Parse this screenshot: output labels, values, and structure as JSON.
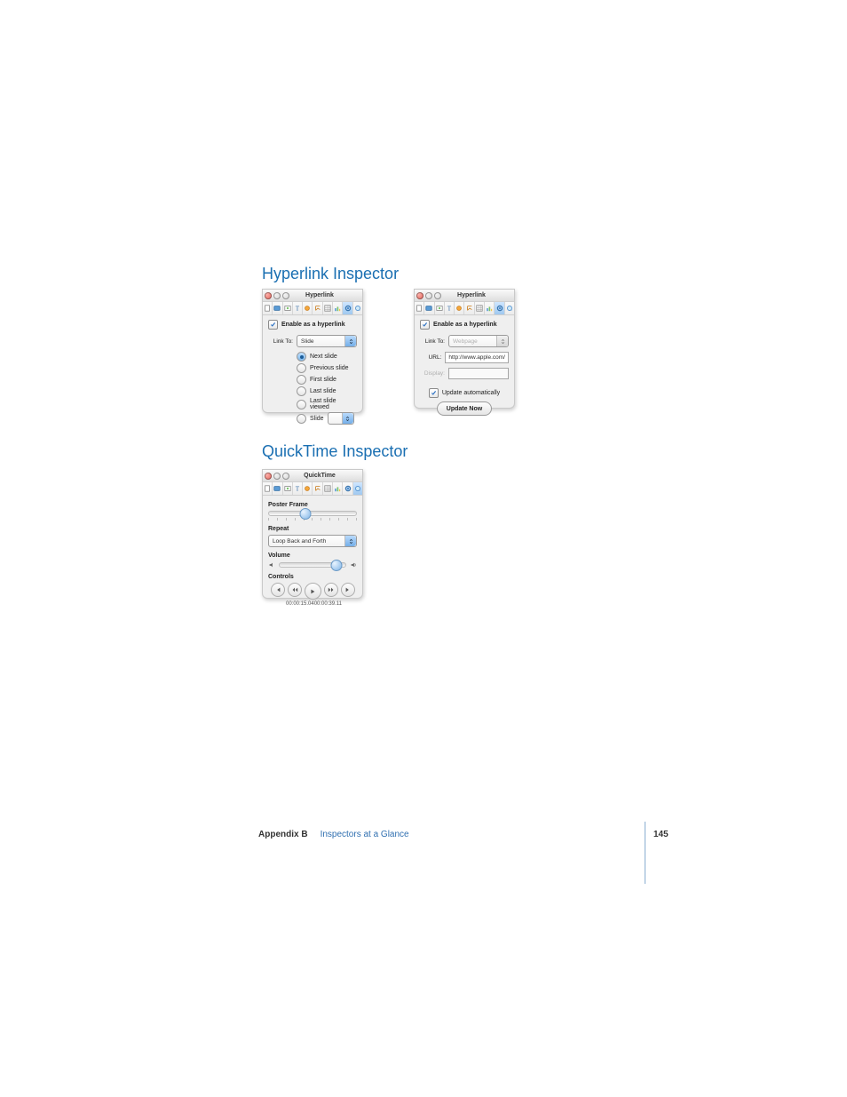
{
  "headings": {
    "hyperlink": "Hyperlink Inspector",
    "quicktime": "QuickTime Inspector"
  },
  "hyperlink_slide": {
    "title": "Hyperlink",
    "enable_label": "Enable as a hyperlink",
    "link_to_label": "Link To:",
    "link_to_value": "Slide",
    "options": {
      "next": "Next slide",
      "previous": "Previous slide",
      "first": "First slide",
      "last": "Last slide",
      "last_viewed": "Last slide viewed",
      "slide": "Slide"
    }
  },
  "hyperlink_web": {
    "title": "Hyperlink",
    "enable_label": "Enable as a hyperlink",
    "link_to_label": "Link To:",
    "link_to_value": "Webpage",
    "url_label": "URL:",
    "url_value": "http://www.apple.com/",
    "display_label": "Display:",
    "display_value": "",
    "update_auto_label": "Update automatically",
    "update_now_label": "Update Now"
  },
  "quicktime": {
    "title": "QuickTime",
    "poster_label": "Poster Frame",
    "repeat_label": "Repeat",
    "repeat_value": "Loop Back and Forth",
    "volume_label": "Volume",
    "controls_label": "Controls",
    "time_left": "00:00:15.04",
    "time_right": "00:00:39.11"
  },
  "footer": {
    "appendix": "Appendix B",
    "section": "Inspectors at a Glance",
    "page": "145"
  },
  "icons": {
    "doc": "doc-icon",
    "slide": "slide-icon",
    "build": "build-icon",
    "text": "text-icon",
    "graphic": "graphic-icon",
    "metrics": "metrics-icon",
    "table": "table-icon",
    "chart": "chart-icon",
    "hyperlink": "hyperlink-icon",
    "qt": "quicktime-icon"
  }
}
